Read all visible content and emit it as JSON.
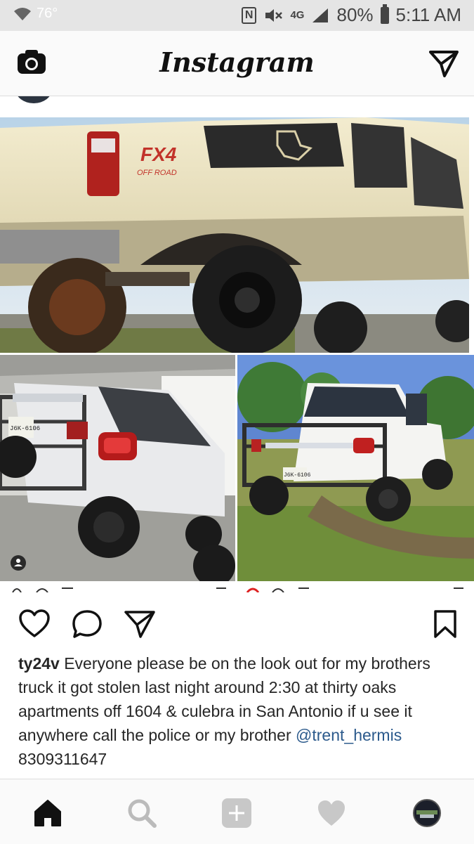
{
  "status_bar": {
    "temperature": "76°",
    "nfc": "N",
    "network": "4G",
    "battery": "80%",
    "time": "5:11 AM"
  },
  "app": {
    "title": "Instagram"
  },
  "post": {
    "username": "ty24v",
    "caption": "Everyone please be on the look out for my brothers truck it got stolen last night around 2:30 at thirty oaks apartments off 1604 & culebra in San Antonio if u see it anywhere call the police or my brother",
    "mention": "@trent_hermis",
    "phone": "8309311647",
    "photos": {
      "top_badge": "FX4",
      "top_badge_sub": "OFF ROAD",
      "plate_left": "J6K-6106",
      "plate_right": "J6K-6106"
    }
  },
  "icons": {
    "camera": "camera-icon",
    "direct": "direct-message-icon",
    "like": "heart-icon",
    "comment": "comment-icon",
    "share": "share-icon",
    "save": "bookmark-icon",
    "home": "home-icon",
    "search": "search-icon",
    "add": "add-icon",
    "activity": "heart-icon",
    "profile": "profile-avatar"
  },
  "colors": {
    "mention": "#2c5a8c",
    "status_bar_bg": "#e5e5e5",
    "tab_bar_bg": "#fafafa"
  }
}
